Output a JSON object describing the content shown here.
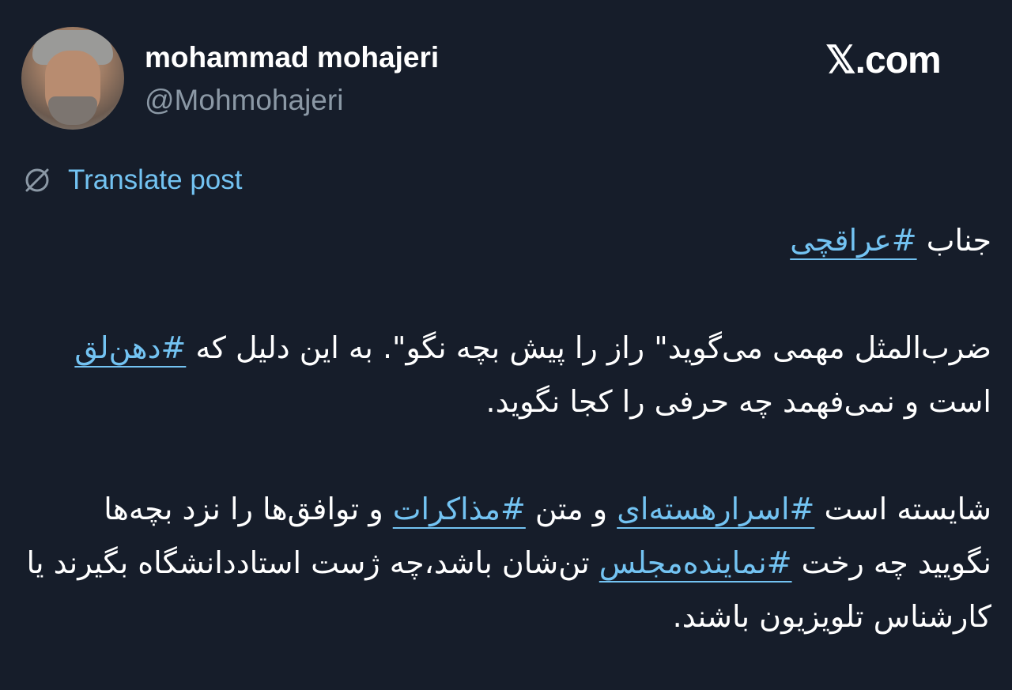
{
  "author": {
    "display_name": "mohammad mohajeri",
    "handle": "@Mohmohajeri"
  },
  "brand": "𝕏.com",
  "translate": {
    "label": "Translate post",
    "icon": "translate-globe-icon"
  },
  "post": {
    "line1_text": "جناب ",
    "line1_tag": "#عراقچی",
    "para2_text_a": "ضرب‌المثل مهمی  می‌گوید\" راز را پیش بچه نگو\". به این دلیل که ",
    "para2_tag": "#دهن‌لق",
    "para2_text_b": " است و نمی‌فهمد چه حرفی را کجا نگوید.",
    "para3_text_a": "شایسته است ",
    "para3_tag1": "#اسرارهسته‌ای",
    "para3_text_b": " و متن ",
    "para3_tag2": "#مذاکرات",
    "para3_text_c": " و توافق‌ها را نزد بچه‌ها نگویید چه رخت ",
    "para3_tag3": "#نماینده‌مجلس",
    "para3_text_d": " تن‌شان باشد،چه ژست استاددانشگاه بگیرند یا کارشناس تلویزیون باشند."
  },
  "colors": {
    "background": "#161d2a",
    "link": "#73c3f2",
    "secondary_text": "#8b98a5"
  }
}
